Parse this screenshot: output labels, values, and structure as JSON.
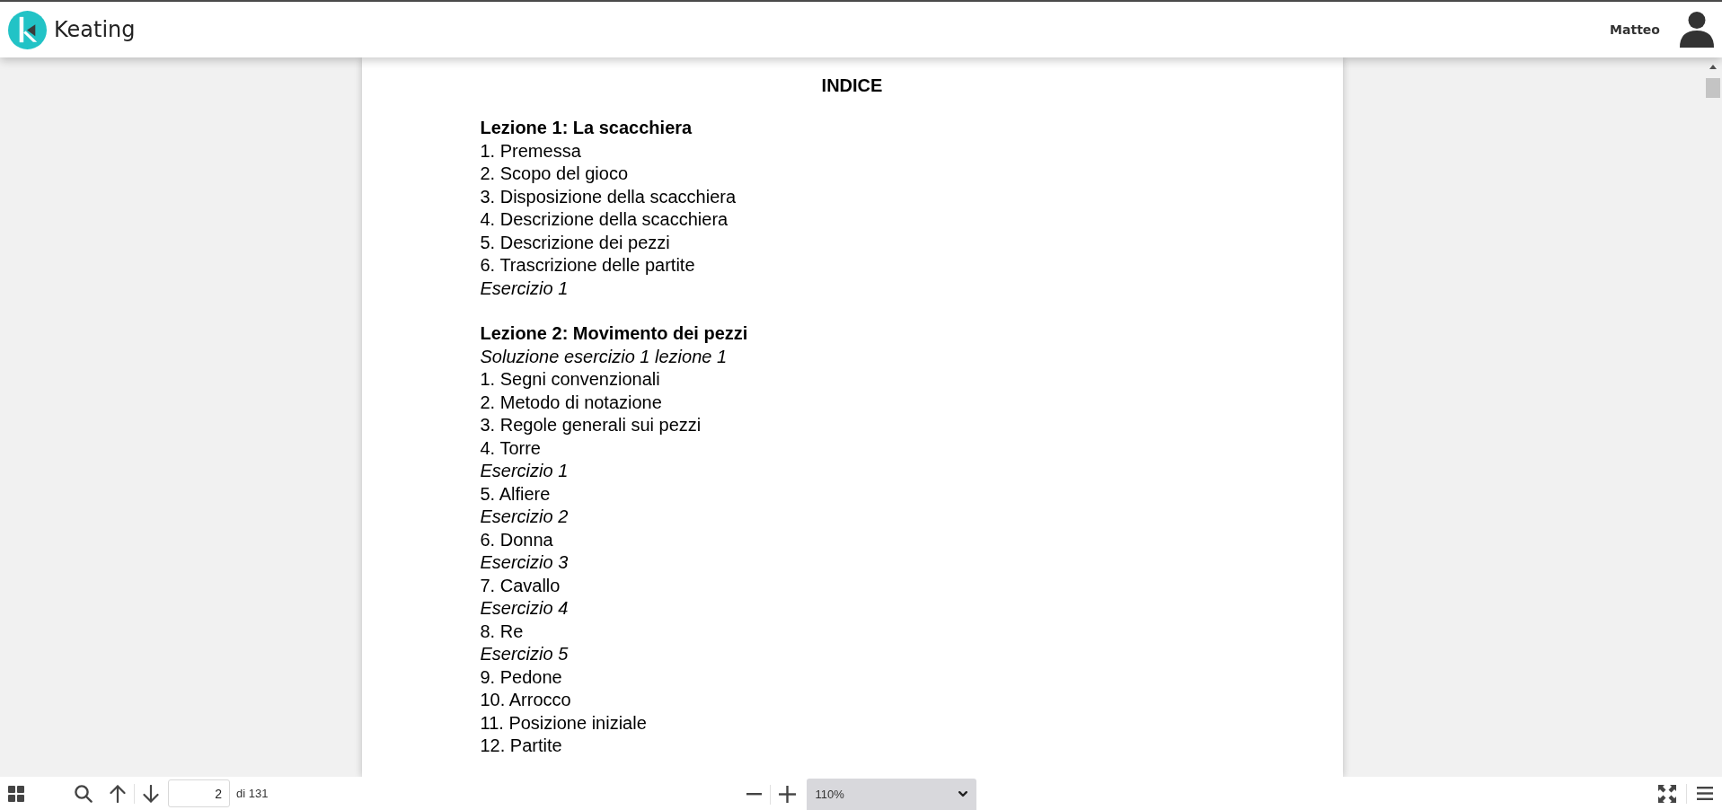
{
  "header": {
    "brand": "Keating",
    "user": "Matteo"
  },
  "document": {
    "title": "INDICE",
    "sections": [
      {
        "heading": "Lezione 1: La scacchiera",
        "entries": [
          {
            "kind": "item",
            "text": "1. Premessa"
          },
          {
            "kind": "item",
            "text": "2. Scopo del gioco"
          },
          {
            "kind": "item",
            "text": "3. Disposizione della scacchiera"
          },
          {
            "kind": "item",
            "text": "4. Descrizione della scacchiera"
          },
          {
            "kind": "item",
            "text": "5. Descrizione dei pezzi"
          },
          {
            "kind": "item",
            "text": "6. Trascrizione delle partite"
          },
          {
            "kind": "exercise",
            "text": "Esercizio 1"
          }
        ]
      },
      {
        "heading": "Lezione 2: Movimento dei pezzi",
        "entries": [
          {
            "kind": "exercise",
            "text": "Soluzione esercizio 1 lezione 1"
          },
          {
            "kind": "item",
            "text": "1. Segni convenzionali"
          },
          {
            "kind": "item",
            "text": "2. Metodo di notazione"
          },
          {
            "kind": "item",
            "text": "3. Regole generali sui pezzi"
          },
          {
            "kind": "item",
            "text": "4. Torre"
          },
          {
            "kind": "exercise",
            "text": "Esercizio 1"
          },
          {
            "kind": "item",
            "text": "5. Alfiere"
          },
          {
            "kind": "exercise",
            "text": "Esercizio 2"
          },
          {
            "kind": "item",
            "text": "6. Donna"
          },
          {
            "kind": "exercise",
            "text": "Esercizio 3"
          },
          {
            "kind": "item",
            "text": "7. Cavallo"
          },
          {
            "kind": "exercise",
            "text": "Esercizio 4"
          },
          {
            "kind": "item",
            "text": "8. Re"
          },
          {
            "kind": "exercise",
            "text": "Esercizio 5"
          },
          {
            "kind": "item",
            "text": "9. Pedone"
          },
          {
            "kind": "item",
            "text": "10. Arrocco"
          },
          {
            "kind": "item",
            "text": "11. Posizione iniziale"
          },
          {
            "kind": "item",
            "text": "12. Partite"
          }
        ]
      }
    ]
  },
  "toolbar": {
    "page_field": {
      "value": "2"
    },
    "page_total": "di 131",
    "zoom": "110%"
  }
}
